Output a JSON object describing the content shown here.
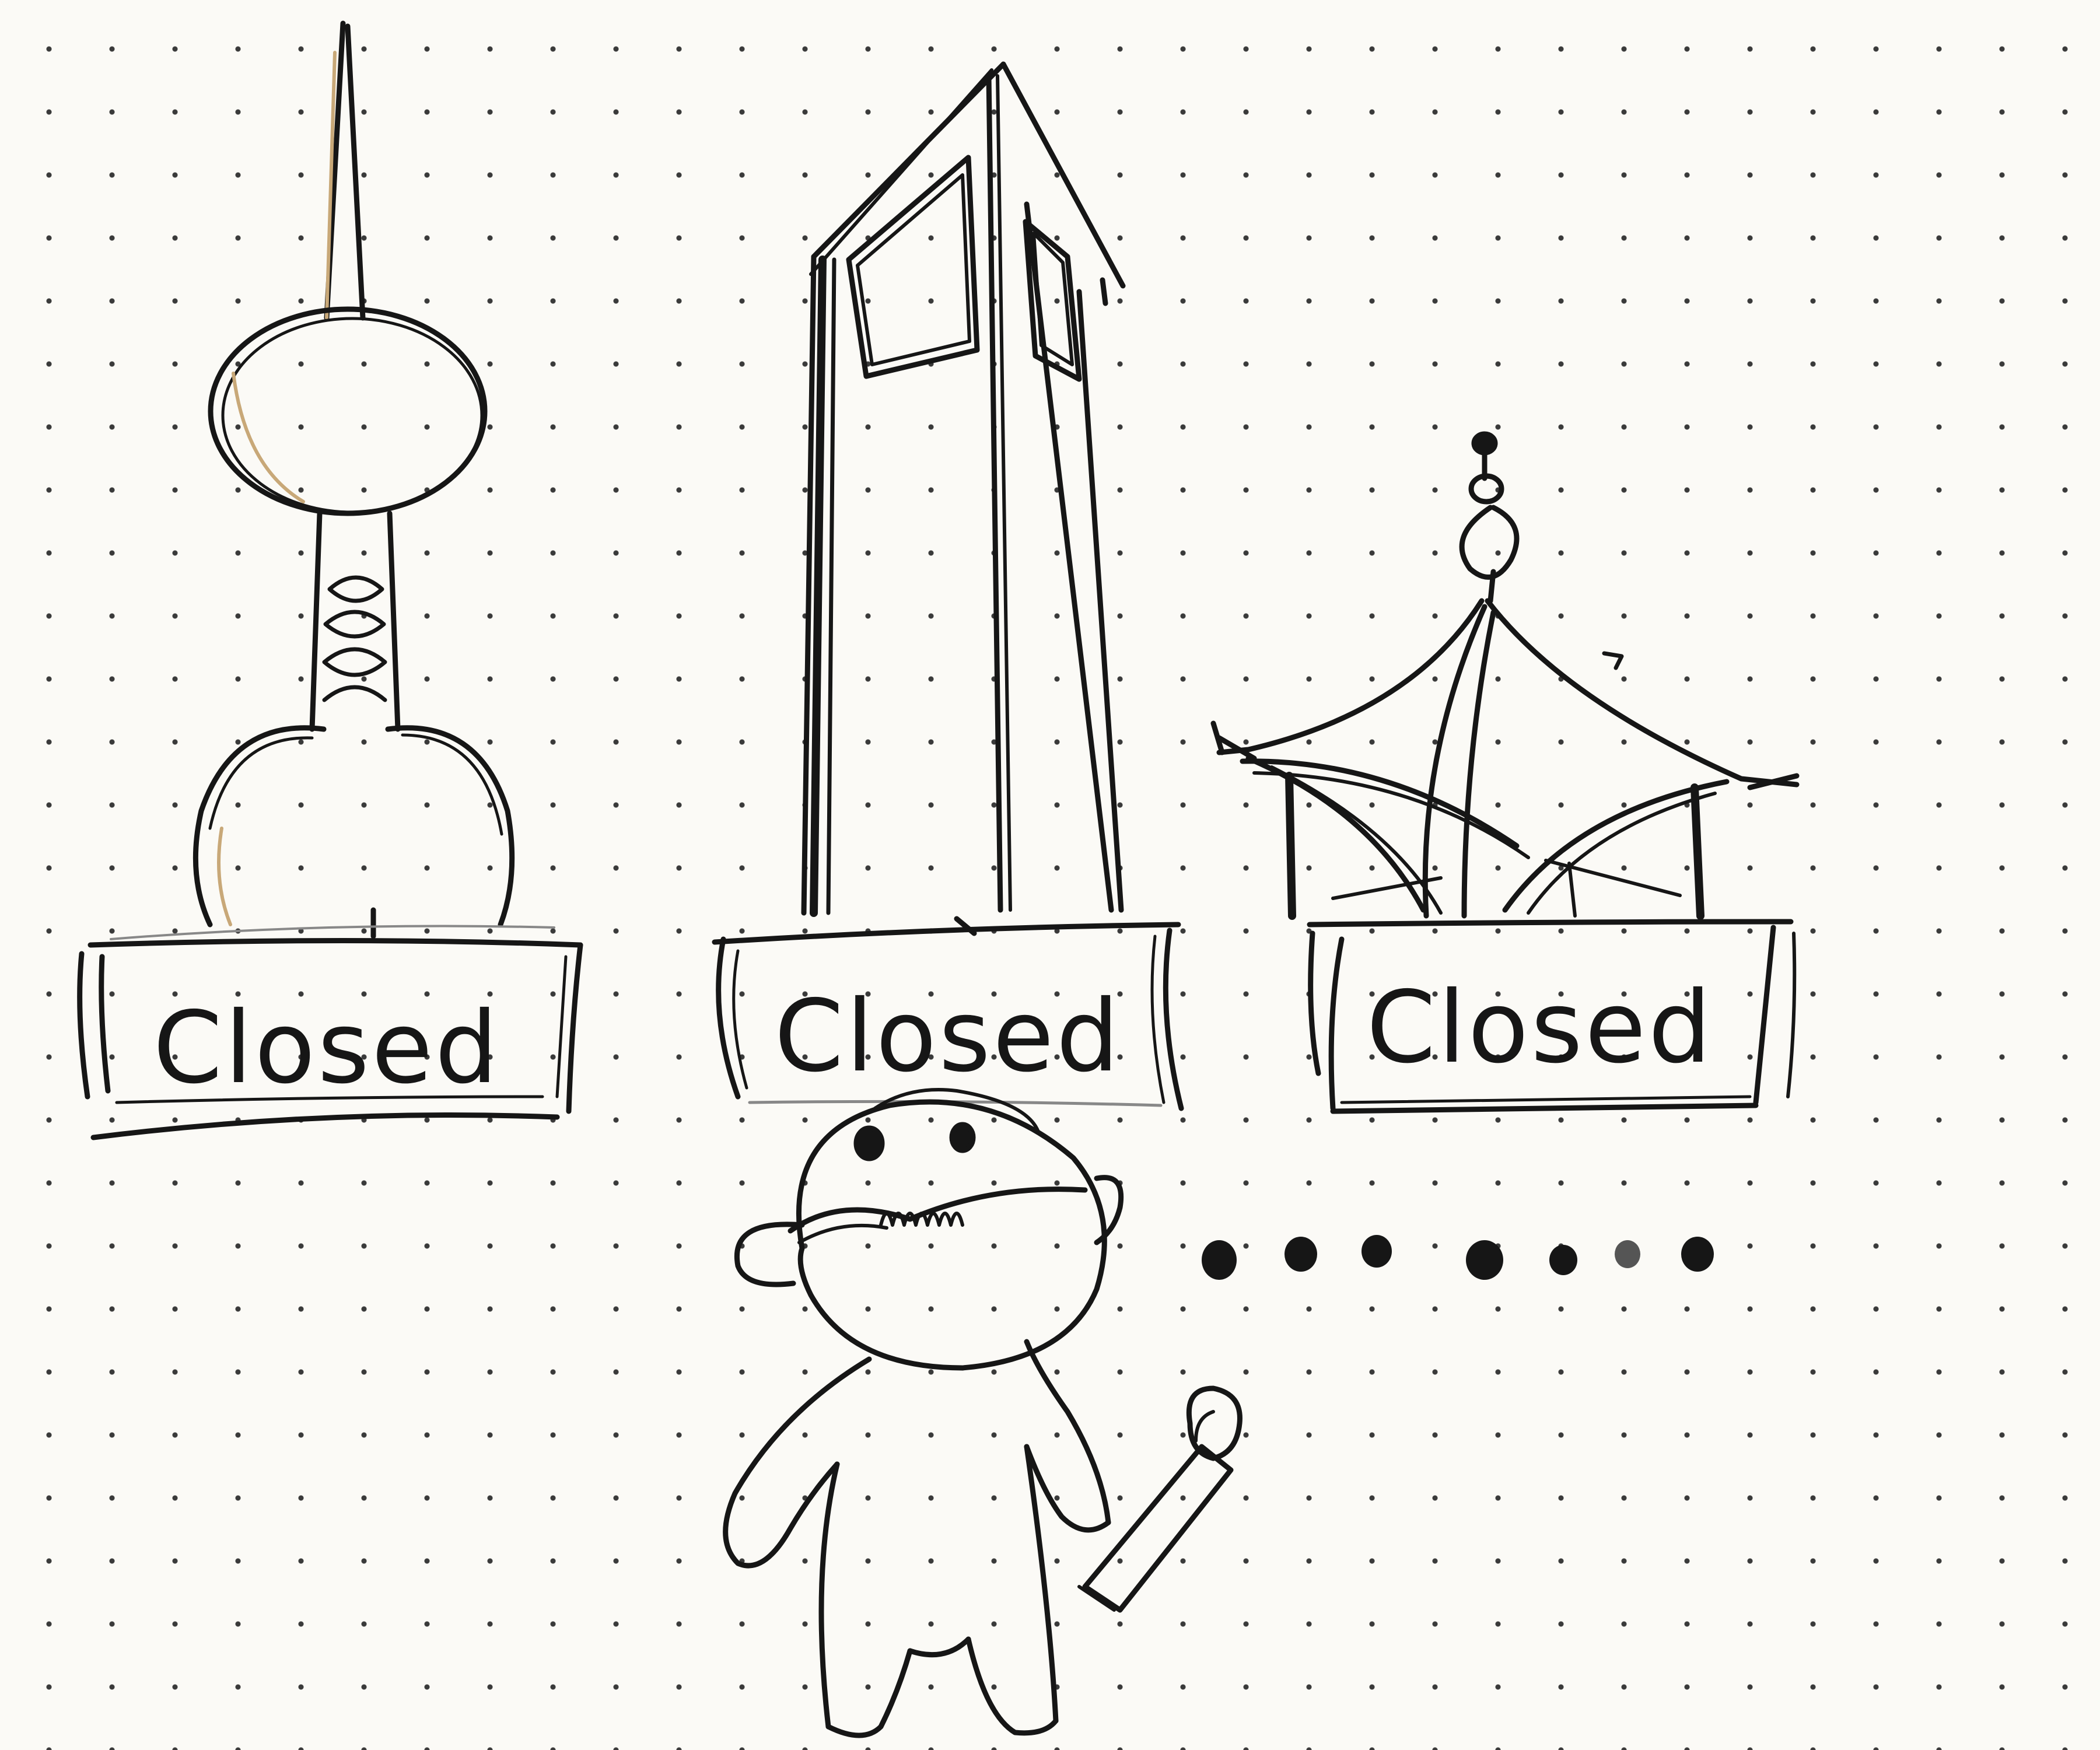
{
  "signs": [
    {
      "label": "Closed"
    },
    {
      "label": "Closed"
    },
    {
      "label": "Closed"
    }
  ],
  "ink_color": "#161616",
  "paper_color": "#fbfaf6",
  "pencil_color": "#c8a878",
  "landmarks": [
    "tv-tower",
    "skyscraper",
    "pavilion"
  ],
  "figure": "sad-person-with-sign-post",
  "trailing_dots_count": 7
}
